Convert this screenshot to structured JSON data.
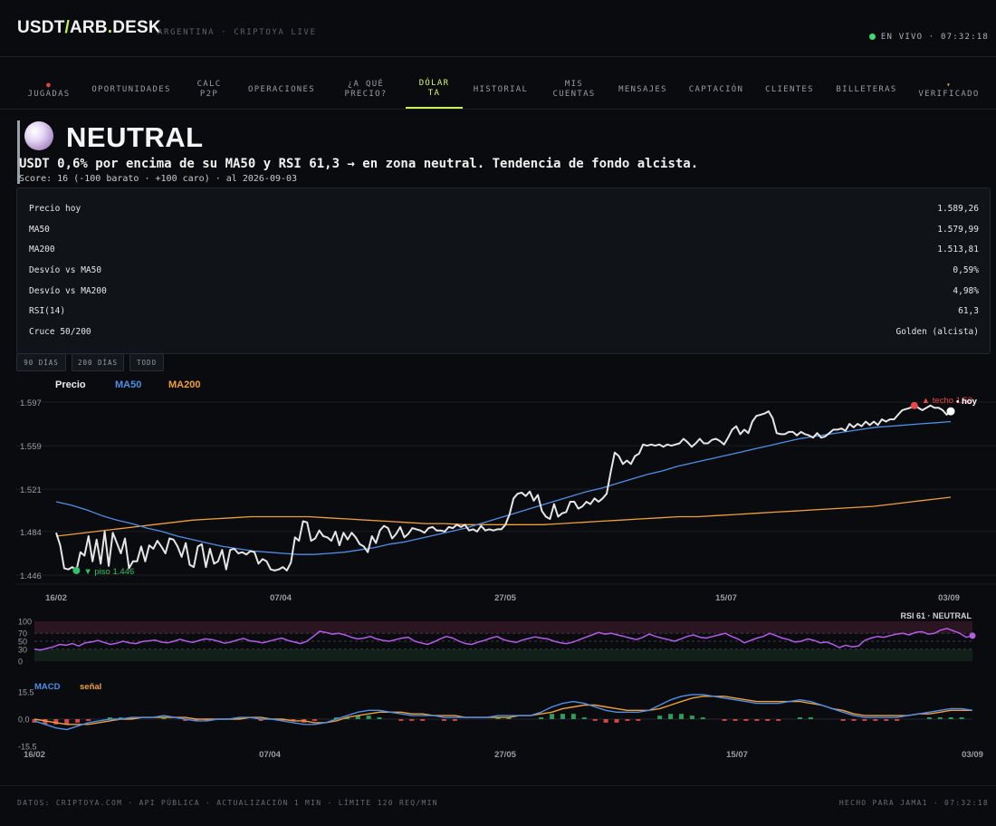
{
  "app": {
    "brand_a": "USDT",
    "brand_slash": "/",
    "brand_b": "ARB",
    "brand_dot": ".",
    "brand_c": "DESK",
    "subtitle": "ARGENTINA · CRIPTOYA LIVE",
    "live_label": "EN VIVO · 07:32:18"
  },
  "nav": {
    "tabs": [
      {
        "label": "JUGADAS",
        "icon": "alert-dot-icon"
      },
      {
        "label": "OPORTUNIDADES"
      },
      {
        "label1": "CALC",
        "label2": "P2P"
      },
      {
        "label": "OPERACIONES"
      },
      {
        "label1": "¿A QUÉ",
        "label2": "PRECIO?"
      },
      {
        "label1": "DÓLAR",
        "label2": "TA",
        "active": true
      },
      {
        "label": "HISTORIAL"
      },
      {
        "label1": "MIS",
        "label2": "CUENTAS"
      },
      {
        "label": "MENSAJES"
      },
      {
        "label": "CAPTACIÓN"
      },
      {
        "label": "CLIENTES"
      },
      {
        "label": "BILLETERAS"
      },
      {
        "label": "VERIFICADO",
        "icon": "shield-icon"
      }
    ]
  },
  "signal": {
    "state": "NEUTRAL",
    "summary": "USDT 0,6% por encima de su MA50 y RSI 61,3 → en zona neutral. Tendencia de fondo alcista.",
    "score": "Score: 16 (-100 barato · +100 caro) · al 2026-09-03"
  },
  "stats": [
    {
      "label": "Precio hoy",
      "value": "1.589,26"
    },
    {
      "label": "MA50",
      "value": "1.579,99"
    },
    {
      "label": "MA200",
      "value": "1.513,81"
    },
    {
      "label": "Desvío vs MA50",
      "value": "0,59%"
    },
    {
      "label": "Desvío vs MA200",
      "value": "4,98%"
    },
    {
      "label": "RSI(14)",
      "value": "61,3"
    },
    {
      "label": "Cruce 50/200",
      "value": "Golden (alcista)"
    }
  ],
  "ranges": [
    "90 DÍAS",
    "200 DÍAS",
    "TODO"
  ],
  "colors": {
    "accent": "#c7f25a",
    "price": "#e6e6e6",
    "ma50": "#4f8fe6",
    "ma200": "#f0a03a",
    "rsi": "#b45be8",
    "macd": "#4f8fe6",
    "signal_line": "#f0a03a",
    "hist_pos": "#2e9d5a",
    "hist_neg": "#d04848",
    "high_marker": "#e84848",
    "low_marker": "#2ec26a"
  },
  "chart_data": [
    {
      "type": "line",
      "legend": [
        "Precio",
        "MA50",
        "MA200"
      ],
      "x_tick_labels": [
        "16/02",
        "07/04",
        "27/05",
        "15/07",
        "03/09"
      ],
      "y_tick_labels": [
        "1.597",
        "1.559",
        "1.521",
        "1.484",
        "1.446"
      ],
      "ylim": [
        1446,
        1597
      ],
      "annotations": {
        "high": "▲ techo 1.59",
        "low": "▼ piso 1.446",
        "today": "• hoy"
      },
      "series": [
        {
          "name": "Precio",
          "values": [
            1483,
            1472,
            1452,
            1451,
            1453,
            1450,
            1466,
            1463,
            1480,
            1458,
            1477,
            1456,
            1484,
            1454,
            1483,
            1474,
            1465,
            1478,
            1452,
            1458,
            1458,
            1471,
            1458,
            1472,
            1469,
            1476,
            1471,
            1465,
            1478,
            1477,
            1471,
            1462,
            1474,
            1455,
            1453,
            1471,
            1473,
            1453,
            1469,
            1456,
            1458,
            1468,
            1451,
            1468,
            1469,
            1465,
            1466,
            1464,
            1467,
            1466,
            1456,
            1460,
            1458,
            1451,
            1450,
            1451,
            1453,
            1450,
            1457,
            1479,
            1476,
            1493,
            1492,
            1476,
            1478,
            1485,
            1480,
            1479,
            1476,
            1484,
            1472,
            1483,
            1477,
            1483,
            1479,
            1473,
            1471,
            1466,
            1480,
            1474,
            1485,
            1489,
            1487,
            1478,
            1482,
            1488,
            1479,
            1482,
            1487,
            1486,
            1485,
            1483,
            1487,
            1488,
            1485,
            1485,
            1484,
            1488,
            1487,
            1490,
            1488,
            1490,
            1485,
            1486,
            1484,
            1489,
            1485,
            1486,
            1485,
            1486,
            1486,
            1490,
            1499,
            1513,
            1517,
            1518,
            1515,
            1519,
            1511,
            1516,
            1502,
            1497,
            1495,
            1508,
            1497,
            1500,
            1501,
            1510,
            1510,
            1504,
            1506,
            1510,
            1508,
            1513,
            1510,
            1513,
            1517,
            1536,
            1553,
            1550,
            1543,
            1546,
            1543,
            1550,
            1552,
            1560,
            1559,
            1560,
            1559,
            1560,
            1558,
            1560,
            1559,
            1560,
            1561,
            1565,
            1562,
            1558,
            1561,
            1565,
            1561,
            1561,
            1564,
            1565,
            1563,
            1560,
            1566,
            1573,
            1576,
            1569,
            1573,
            1570,
            1580,
            1585,
            1586,
            1587,
            1589,
            1583,
            1570,
            1569,
            1569,
            1571,
            1571,
            1568,
            1571,
            1569,
            1568,
            1566,
            1570,
            1566,
            1567,
            1570,
            1573,
            1573,
            1574,
            1572,
            1578,
            1575,
            1578,
            1576,
            1580,
            1577,
            1580,
            1577,
            1582,
            1580,
            1582,
            1582,
            1586,
            1590,
            1591,
            1592,
            1594,
            1592,
            1590,
            1592,
            1594,
            1592,
            1592,
            1590,
            1586,
            1589
          ]
        },
        {
          "name": "MA50",
          "values": [
            1510,
            1507,
            1503,
            1498,
            1494,
            1491,
            1487,
            1484,
            1480,
            1477,
            1474,
            1471,
            1469,
            1467,
            1466,
            1465,
            1464,
            1464,
            1465,
            1466,
            1468,
            1470,
            1473,
            1475,
            1478,
            1481,
            1484,
            1487,
            1491,
            1495,
            1499,
            1503,
            1507,
            1511,
            1515,
            1519,
            1522,
            1526,
            1530,
            1534,
            1537,
            1541,
            1544,
            1547,
            1550,
            1553,
            1556,
            1559,
            1562,
            1565,
            1567,
            1569,
            1571,
            1573,
            1575,
            1576,
            1577,
            1578,
            1579,
            1580
          ]
        },
        {
          "name": "MA200",
          "values": [
            1480,
            1482,
            1484,
            1486,
            1488,
            1490,
            1492,
            1494,
            1495,
            1496,
            1497,
            1497,
            1497,
            1497,
            1496,
            1495,
            1494,
            1493,
            1492,
            1491,
            1491,
            1490,
            1490,
            1490,
            1490,
            1490,
            1491,
            1492,
            1493,
            1494,
            1495,
            1496,
            1497,
            1497,
            1498,
            1499,
            1500,
            1501,
            1502,
            1503,
            1504,
            1505,
            1506,
            1508,
            1510,
            1512,
            1514
          ]
        }
      ]
    },
    {
      "type": "line",
      "label": "RSI 61 · NEUTRAL",
      "y_tick_labels": [
        "100",
        "70",
        "50",
        "30",
        "0"
      ],
      "ylim": [
        0,
        100
      ],
      "series": [
        {
          "name": "RSI",
          "values": [
            30,
            28,
            32,
            36,
            42,
            40,
            44,
            38,
            46,
            48,
            52,
            47,
            42,
            45,
            50,
            46,
            44,
            49,
            51,
            53,
            48,
            46,
            50,
            55,
            50,
            47,
            52,
            56,
            54,
            50,
            45,
            48,
            53,
            57,
            51,
            49,
            46,
            50,
            54,
            58,
            52,
            48,
            44,
            50,
            62,
            75,
            72,
            68,
            70,
            66,
            60,
            56,
            58,
            62,
            56,
            52,
            50,
            54,
            58,
            60,
            50,
            46,
            42,
            48,
            56,
            62,
            58,
            50,
            44,
            42,
            48,
            52,
            58,
            62,
            54,
            50,
            47,
            53,
            57,
            61,
            58,
            56,
            50,
            46,
            44,
            48,
            54,
            60,
            66,
            72,
            68,
            70,
            66,
            62,
            58,
            54,
            60,
            68,
            62,
            58,
            54,
            50,
            56,
            62,
            66,
            60,
            58,
            62,
            66,
            70,
            62,
            56,
            46,
            52,
            58,
            62,
            70,
            64,
            58,
            54,
            48,
            50,
            56,
            52,
            46,
            48,
            42,
            34,
            40,
            36,
            38,
            52,
            58,
            62,
            60,
            64,
            68,
            70,
            66,
            72,
            74,
            68,
            70,
            78,
            82,
            76,
            70,
            60,
            64
          ]
        }
      ]
    },
    {
      "type": "bar",
      "legend": [
        "MACD",
        "señal"
      ],
      "x_tick_labels": [
        "16/02",
        "07/04",
        "27/05",
        "15/07",
        "03/09"
      ],
      "y_tick_labels": [
        "15.5",
        "0.0",
        "-15.5"
      ],
      "ylim": [
        -15.5,
        15.5
      ],
      "series": [
        {
          "name": "MACD",
          "values": [
            -1,
            -3,
            -5,
            -6,
            -4,
            -2,
            -1,
            0,
            0,
            1,
            1,
            1,
            2,
            1,
            0,
            -1,
            -1,
            0,
            0,
            1,
            1,
            0,
            0,
            -1,
            -2,
            -3,
            -3,
            -2,
            0,
            2,
            4,
            5,
            5,
            4,
            3,
            2,
            2,
            2,
            1,
            1,
            1,
            1,
            1,
            2,
            2,
            2,
            2,
            4,
            7,
            9,
            10,
            9,
            7,
            5,
            4,
            4,
            4,
            5,
            8,
            11,
            13,
            14,
            14,
            13,
            12,
            11,
            10,
            9,
            9,
            9,
            10,
            11,
            10,
            8,
            6,
            4,
            2,
            1,
            1,
            1,
            1,
            2,
            3,
            4,
            5,
            6,
            6,
            5
          ]
        },
        {
          "name": "señal",
          "values": [
            0,
            -1,
            -2,
            -3,
            -3,
            -3,
            -2,
            -1,
            0,
            0,
            1,
            1,
            1,
            1,
            1,
            0,
            0,
            0,
            0,
            0,
            1,
            1,
            0,
            0,
            -1,
            -1,
            -2,
            -2,
            -1,
            1,
            2,
            3,
            4,
            4,
            4,
            3,
            3,
            2,
            2,
            2,
            1,
            1,
            1,
            1,
            1,
            2,
            2,
            3,
            4,
            6,
            7,
            8,
            8,
            7,
            6,
            5,
            5,
            5,
            6,
            8,
            10,
            12,
            13,
            13,
            13,
            12,
            11,
            10,
            10,
            10,
            10,
            10,
            9,
            8,
            6,
            5,
            3,
            2,
            2,
            2,
            2,
            2,
            3,
            3,
            4,
            5,
            5,
            5
          ]
        },
        {
          "name": "histograma",
          "values": [
            -2,
            -3,
            -3,
            -3,
            -2,
            -1,
            0,
            1,
            1,
            1,
            0,
            0,
            1,
            0,
            -1,
            -1,
            -1,
            0,
            0,
            1,
            0,
            -1,
            0,
            -1,
            -1,
            -2,
            -1,
            0,
            1,
            1,
            2,
            2,
            1,
            0,
            -1,
            -1,
            -1,
            0,
            -1,
            -1,
            0,
            0,
            0,
            1,
            1,
            0,
            0,
            1,
            3,
            3,
            3,
            1,
            -1,
            -2,
            -2,
            -1,
            -1,
            0,
            2,
            3,
            3,
            2,
            1,
            0,
            -1,
            -1,
            -1,
            -1,
            -1,
            -1,
            0,
            1,
            1,
            0,
            0,
            -1,
            -1,
            -1,
            -1,
            -1,
            -1,
            0,
            0,
            1,
            1,
            1,
            1,
            0
          ]
        }
      ]
    }
  ],
  "footer": {
    "left": "DATOS: CRIPTOYA.COM · API PÚBLICA · ACTUALIZACIÓN 1 MIN · LÍMITE 120 REQ/MIN",
    "right": "HECHO PARA JAMA1 · 07:32:18"
  }
}
